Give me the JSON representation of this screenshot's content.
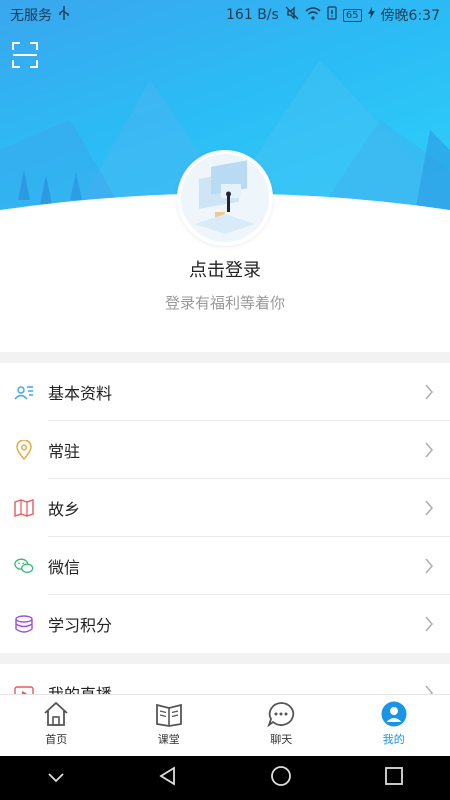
{
  "status_bar": {
    "carrier": "无服务",
    "speed": "161 B/s",
    "battery": "65",
    "time": "傍晚6:37"
  },
  "profile": {
    "login_title": "点击登录",
    "login_subtitle": "登录有福利等着你"
  },
  "menu_group_1": [
    {
      "label": "基本资料",
      "icon": "id-card-icon",
      "color": "#3aa6ee"
    },
    {
      "label": "常驻",
      "icon": "location-pin-icon",
      "color": "#e8a630"
    },
    {
      "label": "故乡",
      "icon": "map-icon",
      "color": "#e85a5a"
    },
    {
      "label": "微信",
      "icon": "wechat-icon",
      "color": "#2fbf71"
    },
    {
      "label": "学习积分",
      "icon": "coin-stack-icon",
      "color": "#a24fd6"
    }
  ],
  "menu_group_2": [
    {
      "label": "我的直播",
      "icon": "live-icon",
      "color": "#e85a5a"
    }
  ],
  "tabbar": {
    "tabs": [
      {
        "label": "首页",
        "icon": "home-icon"
      },
      {
        "label": "课堂",
        "icon": "book-icon"
      },
      {
        "label": "聊天",
        "icon": "chat-icon"
      },
      {
        "label": "我的",
        "icon": "profile-icon"
      }
    ],
    "active": "我的",
    "active_color": "#1a95e6"
  }
}
